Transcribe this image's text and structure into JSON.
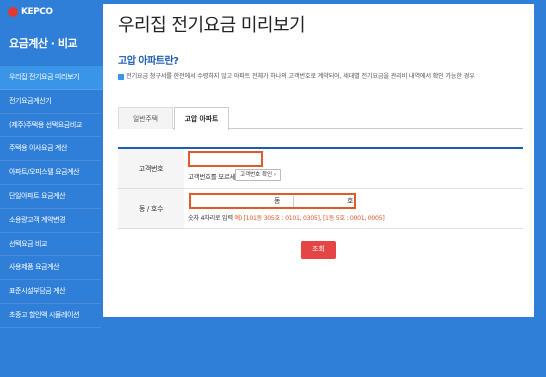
{
  "brand": {
    "logo_text": "KEPCO"
  },
  "sidebar": {
    "title": "요금계산 · 비교",
    "items": [
      {
        "label": "우리집 전기요금 미리보기",
        "active": true
      },
      {
        "label": "전기요금계산기"
      },
      {
        "label": "(제주)주택용 선택요금비교"
      },
      {
        "label": "주택용 이사요금 계산"
      },
      {
        "label": "아파트/오피스텔 요금계산"
      },
      {
        "label": "단일아파트 요금계산"
      },
      {
        "label": "소용량고객 계약변경"
      },
      {
        "label": "선택요금 비교"
      },
      {
        "label": "사용제품 요금계산"
      },
      {
        "label": "표준시설부담금 계산"
      },
      {
        "label": "초중고 할인액 시뮬레이션"
      }
    ]
  },
  "main": {
    "page_title": "우리집 전기요금 미리보기",
    "section_title": "고압 아파트란?",
    "description": "전기요금 청구서를 한전에서 수령하지 않고 아파트 전체가 하나의 고객번호로 계약되어, 세대별 전기요금을 관리비 내역에서 확인 가능한 경우",
    "tabs": [
      {
        "label": "일반주택"
      },
      {
        "label": "고압 아파트",
        "active": true
      }
    ],
    "form": {
      "customer_label": "고객번호",
      "customer_value": "",
      "customer_hint": "고객번호를 모르세요?",
      "customer_check_button": "고객번호 확인 ›",
      "address_label": "동 / 호수",
      "dong_unit": "동",
      "ho_unit": "호",
      "address_hint_prefix": "숫자 4자리로 입력",
      "address_hint_example": "예) [101동 305호 : 0101, 0305], [1동 5호 : 0001, 0005]"
    },
    "search_button": "조회"
  },
  "colors": {
    "accent": "#2f7fd9",
    "highlight": "#e05a2b",
    "button": "#e54545",
    "section_title": "#1f5cb5"
  }
}
